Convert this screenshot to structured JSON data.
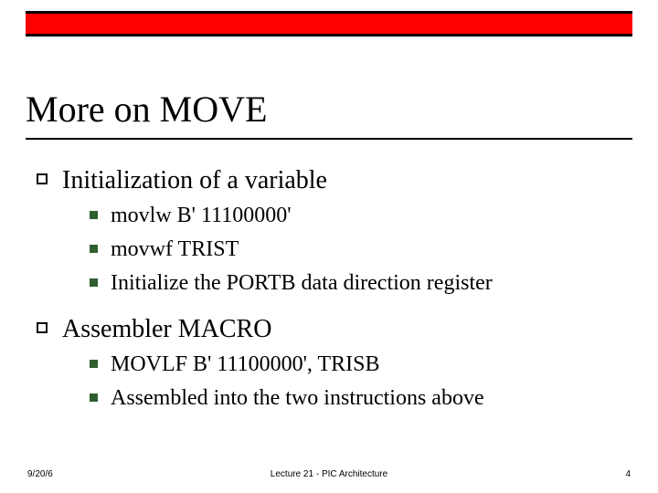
{
  "slide": {
    "title": "More on MOVE",
    "sections": [
      {
        "label": "Initialization of a variable",
        "items": [
          "movlw   B' 11100000'",
          "movwf   TRIST",
          "Initialize the PORTB data direction register"
        ]
      },
      {
        "label": "Assembler MACRO",
        "items": [
          "MOVLF   B' 11100000', TRISB",
          "Assembled into the two instructions above"
        ]
      }
    ],
    "footer": {
      "date": "9/20/6",
      "center": "Lecture 21 - PIC Architecture",
      "page": "4"
    }
  }
}
